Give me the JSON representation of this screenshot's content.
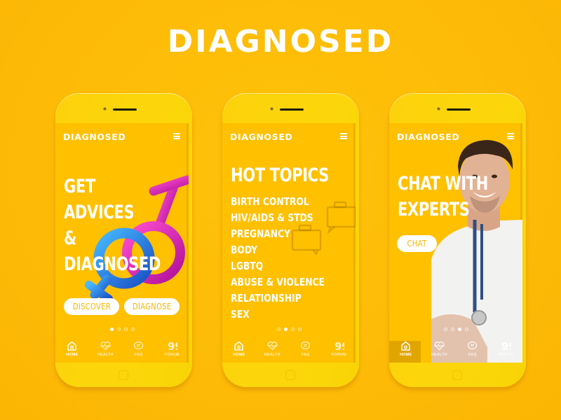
{
  "brand": {
    "title": "DIAGNOSED"
  },
  "phones": [
    {
      "app_title": "DIAGNOSED",
      "headline": [
        "GET",
        "ADVICES",
        "&",
        "DIAGNOSED"
      ],
      "buttons": [
        {
          "label": "DISCOVER"
        },
        {
          "label": "DIAGNOSE"
        }
      ],
      "carousel": {
        "total": 4,
        "active": 1
      },
      "tabs": [
        {
          "label": "HOME",
          "icon": "home-icon",
          "active": true
        },
        {
          "label": "HEALTH",
          "icon": "heart-pulse-icon",
          "active": false
        },
        {
          "label": "FAQ",
          "icon": "chat-bubble-icon",
          "active": false
        },
        {
          "label": "FORUM",
          "icon": "quote-icon",
          "active": false
        }
      ]
    },
    {
      "app_title": "DIAGNOSED",
      "headline": [
        "HOT TOPICS"
      ],
      "topics": [
        "BIRTH CONTROL",
        "HIV/AIDS & STDS",
        "PREGNANCY",
        "BODY",
        "LGBTQ",
        "ABUSE & VIOLENCE",
        "RELATIONSHIP",
        "SEX"
      ],
      "carousel": {
        "total": 4,
        "active": 2
      },
      "tabs": [
        {
          "label": "HOME",
          "icon": "home-icon",
          "active": true
        },
        {
          "label": "HEALTH",
          "icon": "heart-pulse-icon",
          "active": false
        },
        {
          "label": "FAQ",
          "icon": "chat-bubble-icon",
          "active": false
        },
        {
          "label": "FORUM",
          "icon": "quote-icon",
          "active": false
        }
      ]
    },
    {
      "app_title": "DIAGNOSED",
      "headline": [
        "CHAT WITH",
        "EXPERTS"
      ],
      "buttons": [
        {
          "label": "CHAT"
        }
      ],
      "carousel": {
        "total": 4,
        "active": 3
      },
      "tabs": [
        {
          "label": "HOME",
          "icon": "home-icon",
          "active": true
        },
        {
          "label": "HEALTH",
          "icon": "heart-pulse-icon",
          "active": false
        },
        {
          "label": "FAQ",
          "icon": "chat-bubble-icon",
          "active": false
        },
        {
          "label": "FORUM",
          "icon": "quote-icon",
          "active": false
        }
      ]
    }
  ],
  "colors": {
    "background": "#fdbb07",
    "screen": "#ffc000",
    "phone_body": "#fcd20c",
    "accent_text": "#f5b800",
    "white": "#ffffff"
  }
}
